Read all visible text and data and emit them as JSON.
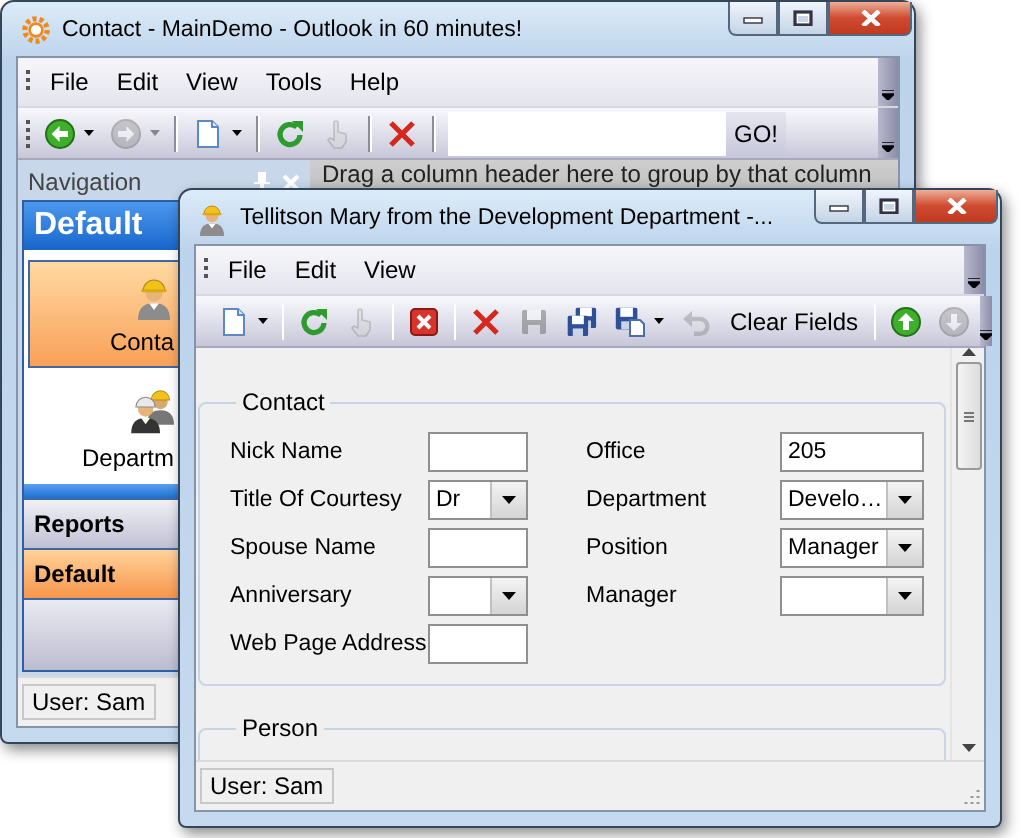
{
  "back_window": {
    "title": "Contact - MainDemo - Outlook in 60 minutes!",
    "menu": [
      "File",
      "Edit",
      "View",
      "Tools",
      "Help"
    ],
    "toolbar": [
      {
        "kind": "back",
        "disabled": false,
        "dropdown": true
      },
      {
        "kind": "forward",
        "disabled": true,
        "dropdown": true
      },
      {
        "kind": "separator"
      },
      {
        "kind": "new",
        "disabled": false,
        "dropdown": true
      },
      {
        "kind": "separator"
      },
      {
        "kind": "refresh",
        "disabled": false,
        "dropdown": false
      },
      {
        "kind": "hand",
        "disabled": true,
        "dropdown": false
      },
      {
        "kind": "separator"
      },
      {
        "kind": "delete",
        "disabled": false,
        "dropdown": false
      },
      {
        "kind": "separator"
      },
      {
        "kind": "address",
        "button": "GO!"
      }
    ],
    "navigation": {
      "title": "Navigation",
      "group": "Default",
      "items": [
        {
          "label": "Conta",
          "kind": "contact",
          "selected": true
        },
        {
          "label": "Departm",
          "kind": "department",
          "selected": false
        }
      ],
      "groups": [
        {
          "label": "Reports",
          "selected": false
        },
        {
          "label": "Default",
          "selected": true
        }
      ]
    },
    "grid_hint": "Drag a column header here to group by that column",
    "status": "User: Sam"
  },
  "front_window": {
    "title": "Tellitson Mary from the Development Department -...",
    "menu": [
      "File",
      "Edit",
      "View"
    ],
    "toolbar": [
      {
        "kind": "new",
        "disabled": false,
        "dropdown": true
      },
      {
        "kind": "separator"
      },
      {
        "kind": "refresh",
        "disabled": false,
        "dropdown": false
      },
      {
        "kind": "hand",
        "disabled": true,
        "dropdown": false
      },
      {
        "kind": "separator"
      },
      {
        "kind": "cancel",
        "disabled": false,
        "dropdown": false
      },
      {
        "kind": "separator"
      },
      {
        "kind": "delete",
        "disabled": false,
        "dropdown": false
      },
      {
        "kind": "save",
        "disabled": true,
        "dropdown": false
      },
      {
        "kind": "save-copy",
        "disabled": false,
        "dropdown": false
      },
      {
        "kind": "save-as",
        "disabled": false,
        "dropdown": true
      },
      {
        "kind": "undo",
        "disabled": true,
        "dropdown": false
      },
      {
        "kind": "text",
        "label": "Clear Fields",
        "disabled": false
      },
      {
        "kind": "separator"
      },
      {
        "kind": "up",
        "disabled": false,
        "dropdown": false
      },
      {
        "kind": "down",
        "disabled": true,
        "dropdown": false
      }
    ],
    "sections": [
      {
        "title": "Contact",
        "left": [
          {
            "label": "Nick Name",
            "kind": "text"
          },
          {
            "label": "Title Of Courtesy",
            "kind": "combo",
            "value": "Dr"
          },
          {
            "label": "Spouse Name",
            "kind": "text"
          },
          {
            "label": "Anniversary",
            "kind": "combo"
          },
          {
            "label": "Web Page Address",
            "kind": "text"
          }
        ],
        "right": [
          {
            "label": "Office",
            "kind": "text",
            "value": "205"
          },
          {
            "label": "Department",
            "kind": "combo",
            "value": "Develo…"
          },
          {
            "label": "Position",
            "kind": "combo",
            "value": "Manager"
          },
          {
            "label": "Manager",
            "kind": "combo"
          }
        ]
      },
      {
        "title": "Person"
      }
    ],
    "status": "User: Sam"
  }
}
